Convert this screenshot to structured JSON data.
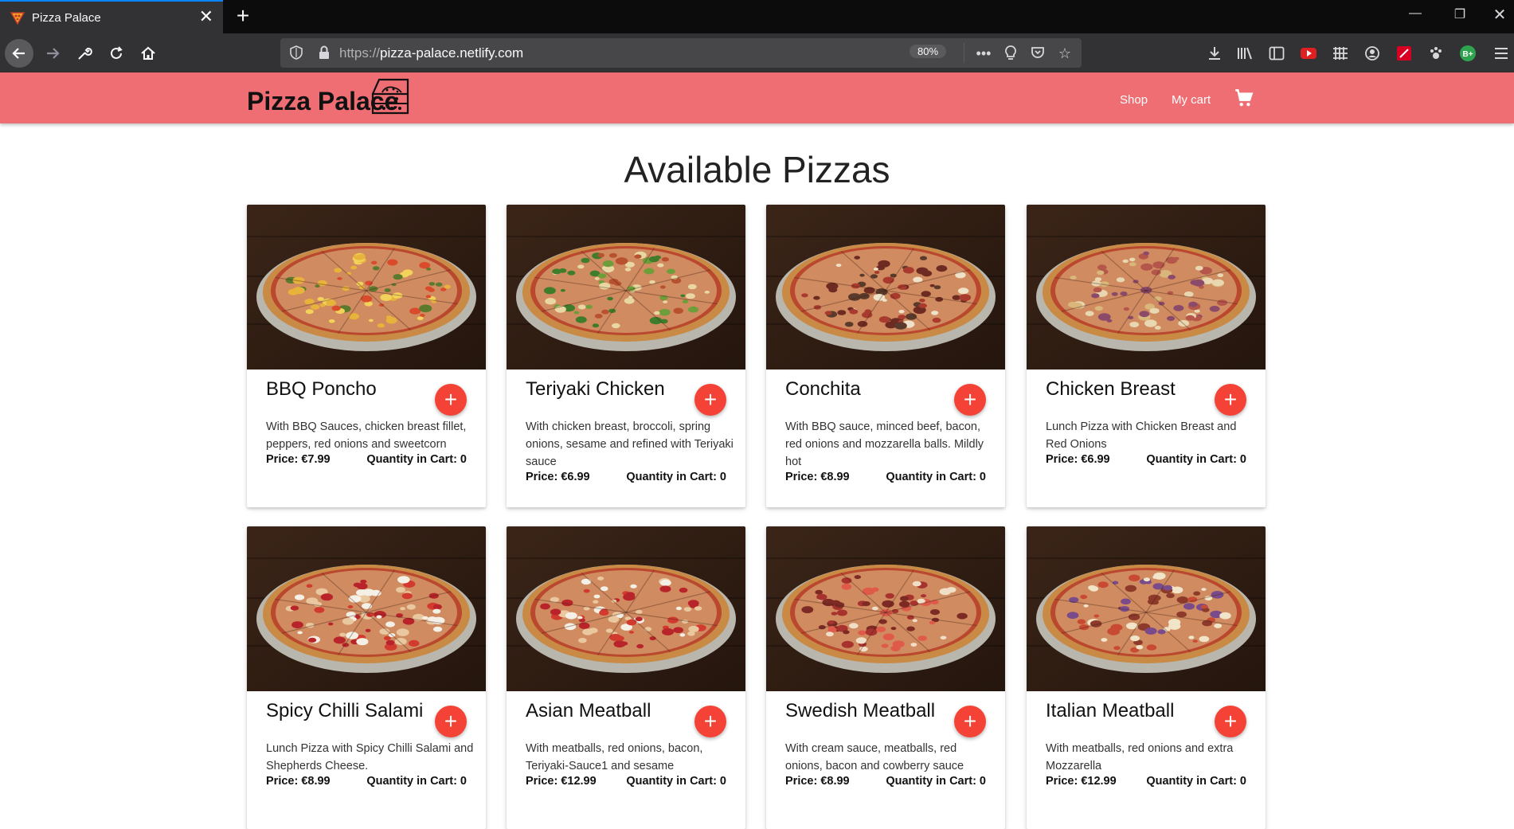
{
  "browser": {
    "tab_title": "Pizza Palace",
    "url_scheme": "https://",
    "url_host": "pizza-palace.netlify.com",
    "zoom": "80%"
  },
  "header": {
    "brand": "Pizza Palace",
    "nav_shop": "Shop",
    "nav_cart": "My cart"
  },
  "main": {
    "title": "Available Pizzas",
    "add_label": "+",
    "pizzas": [
      {
        "name": "BBQ Poncho",
        "description": "With BBQ Sauces, chicken breast fillet, peppers, red onions and sweetcorn",
        "price": "Price: €7.99",
        "quantity": "Quantity in Cart: 0"
      },
      {
        "name": "Teriyaki Chicken",
        "description": "With chicken breast, broccoli, spring onions, sesame and refined with Teriyaki sauce",
        "price": "Price: €6.99",
        "quantity": "Quantity in Cart: 0"
      },
      {
        "name": "Conchita",
        "description": "With BBQ sauce, minced beef, bacon, red onions and mozzarella balls. Mildly hot",
        "price": "Price: €8.99",
        "quantity": "Quantity in Cart: 0"
      },
      {
        "name": "Chicken Breast",
        "description": "Lunch Pizza with Chicken Breast and Red Onions",
        "price": "Price: €6.99",
        "quantity": "Quantity in Cart: 0"
      },
      {
        "name": "Spicy Chilli Salami",
        "description": "Lunch Pizza with Spicy Chilli Salami and Shepherds Cheese.",
        "price": "Price: €8.99",
        "quantity": "Quantity in Cart: 0"
      },
      {
        "name": "Asian Meatball",
        "description": "With meatballs, red onions, bacon, Teriyaki-Sauce1 and sesame",
        "price": "Price: €12.99",
        "quantity": "Quantity in Cart: 0"
      },
      {
        "name": "Swedish Meatball",
        "description": "With cream sauce, meatballs, red onions, bacon and cowberry sauce",
        "price": "Price: €8.99",
        "quantity": "Quantity in Cart: 0"
      },
      {
        "name": "Italian Meatball",
        "description": "With meatballs, red onions and extra Mozzarella",
        "price": "Price: €12.99",
        "quantity": "Quantity in Cart: 0"
      }
    ]
  },
  "colors": {
    "header_bg": "#ee6e73",
    "add_button": "#f44336",
    "tab_accent": "#0a84ff"
  }
}
